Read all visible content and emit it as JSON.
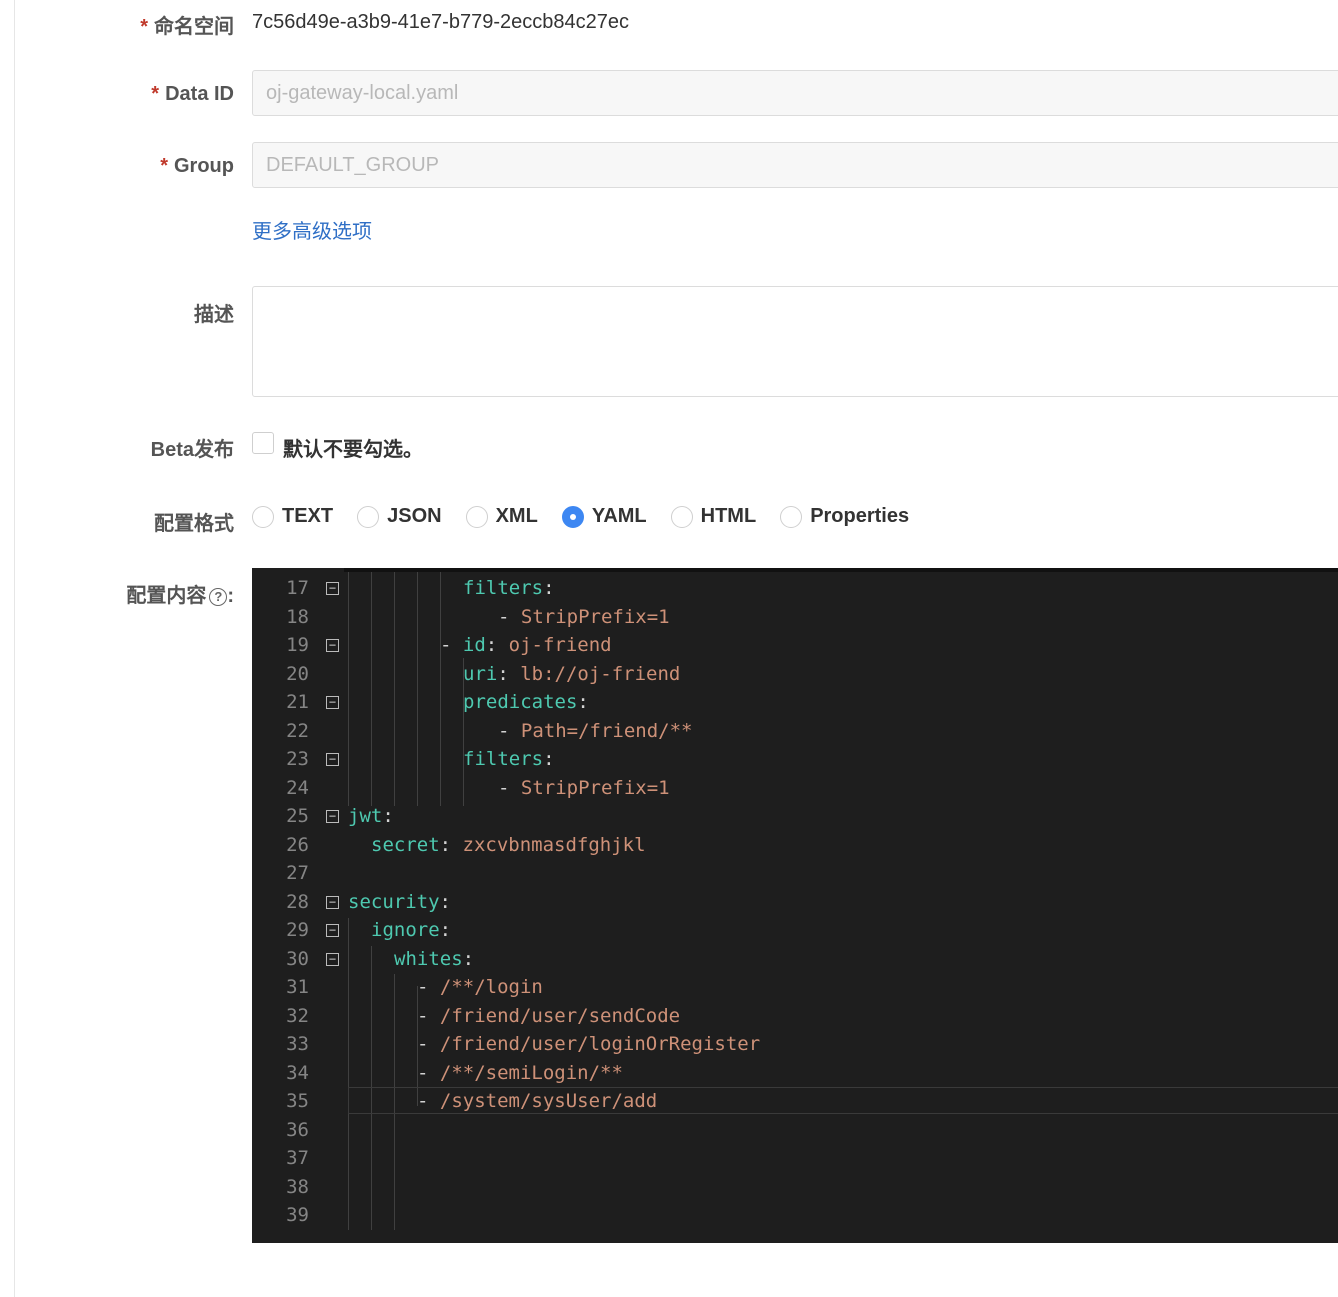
{
  "form": {
    "namespace": {
      "label": "命名空间",
      "required_mark": "*",
      "value": "7c56d49e-a3b9-41e7-b779-2eccb84c27ec"
    },
    "data_id": {
      "label": "Data ID",
      "required_mark": "*",
      "value": "oj-gateway-local.yaml"
    },
    "group": {
      "label": "Group",
      "required_mark": "*",
      "value": "DEFAULT_GROUP"
    },
    "advanced_link": "更多高级选项",
    "description": {
      "label": "描述",
      "value": ""
    },
    "beta": {
      "label": "Beta发布",
      "checkbox_text": "默认不要勾选。",
      "checked": false
    },
    "format": {
      "label": "配置格式",
      "options": [
        "TEXT",
        "JSON",
        "XML",
        "YAML",
        "HTML",
        "Properties"
      ],
      "selected": "YAML"
    },
    "content": {
      "label": "配置内容",
      "help_icon": "question-circle-icon",
      "colon": ":"
    }
  },
  "editor": {
    "lines": [
      {
        "n": "17",
        "fold": true
      },
      {
        "n": "18",
        "fold": false
      },
      {
        "n": "19",
        "fold": true
      },
      {
        "n": "20",
        "fold": false
      },
      {
        "n": "21",
        "fold": true
      },
      {
        "n": "22",
        "fold": false
      },
      {
        "n": "23",
        "fold": true
      },
      {
        "n": "24",
        "fold": false
      },
      {
        "n": "25",
        "fold": true
      },
      {
        "n": "26",
        "fold": false
      },
      {
        "n": "27",
        "fold": false
      },
      {
        "n": "28",
        "fold": true
      },
      {
        "n": "29",
        "fold": true
      },
      {
        "n": "30",
        "fold": true
      },
      {
        "n": "31",
        "fold": false
      },
      {
        "n": "32",
        "fold": false
      },
      {
        "n": "33",
        "fold": false
      },
      {
        "n": "34",
        "fold": false
      },
      {
        "n": "35",
        "fold": false
      },
      {
        "n": "36",
        "fold": false
      },
      {
        "n": "37",
        "fold": false
      },
      {
        "n": "38",
        "fold": false
      },
      {
        "n": "39",
        "fold": false
      }
    ],
    "code": {
      "l17": {
        "key": "filters",
        "colon": ":"
      },
      "l18": {
        "dash": "- ",
        "value": "StripPrefix=1"
      },
      "l19": {
        "dash": "- ",
        "key": "id",
        "colon": ": ",
        "value": "oj-friend"
      },
      "l20": {
        "key": "uri",
        "colon": ": ",
        "value": "lb://oj-friend"
      },
      "l21": {
        "key": "predicates",
        "colon": ":"
      },
      "l22": {
        "dash": "- ",
        "value": "Path=/friend/**"
      },
      "l23": {
        "key": "filters",
        "colon": ":"
      },
      "l24": {
        "dash": "- ",
        "value": "StripPrefix=1"
      },
      "l25": {
        "key": "jwt",
        "colon": ":"
      },
      "l26": {
        "key": "secret",
        "colon": ": ",
        "value": "zxcvbnmasdfghjkl"
      },
      "l28": {
        "key": "security",
        "colon": ":"
      },
      "l29": {
        "key": "ignore",
        "colon": ":"
      },
      "l30": {
        "key": "whites",
        "colon": ":"
      },
      "l31": {
        "dash": "- ",
        "value": "/**/login"
      },
      "l32": {
        "dash": "- ",
        "value": "/friend/user/sendCode"
      },
      "l33": {
        "dash": "- ",
        "value": "/friend/user/loginOrRegister"
      },
      "l34": {
        "dash": "- ",
        "value": "/**/semiLogin/**"
      },
      "l35": {
        "dash": "- ",
        "value": "/system/sysUser/add"
      }
    },
    "fold_glyph": "−",
    "colors": {
      "background": "#1e1e1e",
      "key": "#4ec9b0",
      "string": "#ce9178",
      "line_number": "#858585"
    }
  },
  "colors": {
    "accent": "#3d87f2",
    "link": "#2f6fc6",
    "required": "#c0392b"
  }
}
